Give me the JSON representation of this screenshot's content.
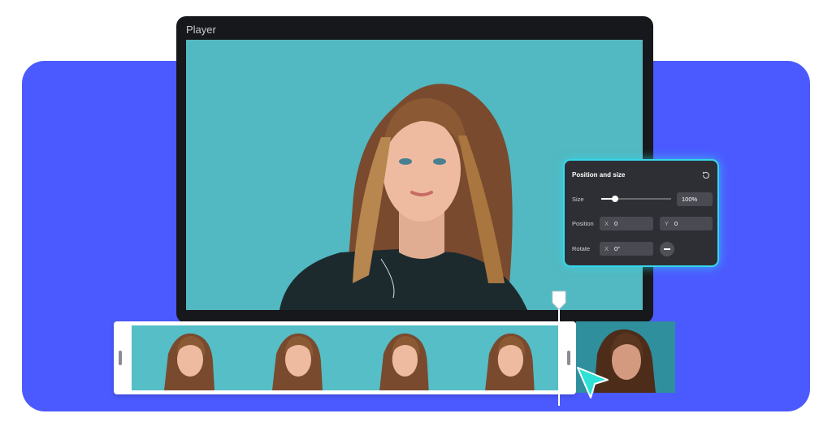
{
  "player": {
    "title": "Player"
  },
  "position_size_panel": {
    "title": "Position and size",
    "size_label": "Size",
    "size_value": "100%",
    "size_slider_fraction": 0.2,
    "position_label": "Position",
    "position_x_axis": "X",
    "position_x_value": "0",
    "position_y_axis": "Y",
    "position_y_value": "0",
    "rotate_label": "Rotate",
    "rotate_axis": "X",
    "rotate_value": "0°"
  },
  "icons": {
    "reset": "reset-icon",
    "rotate": "rotate-knob-icon",
    "cursor": "pointer-cursor-icon",
    "playhead": "playhead-marker-icon"
  },
  "colors": {
    "background_panel": "#4b5aff",
    "accent": "#35d9ea",
    "photo_background": "#52b8c1"
  },
  "timeline": {
    "frames": [
      {
        "name": "timeline-frame-1"
      },
      {
        "name": "timeline-frame-2"
      },
      {
        "name": "timeline-frame-3"
      },
      {
        "name": "timeline-frame-4"
      }
    ]
  }
}
